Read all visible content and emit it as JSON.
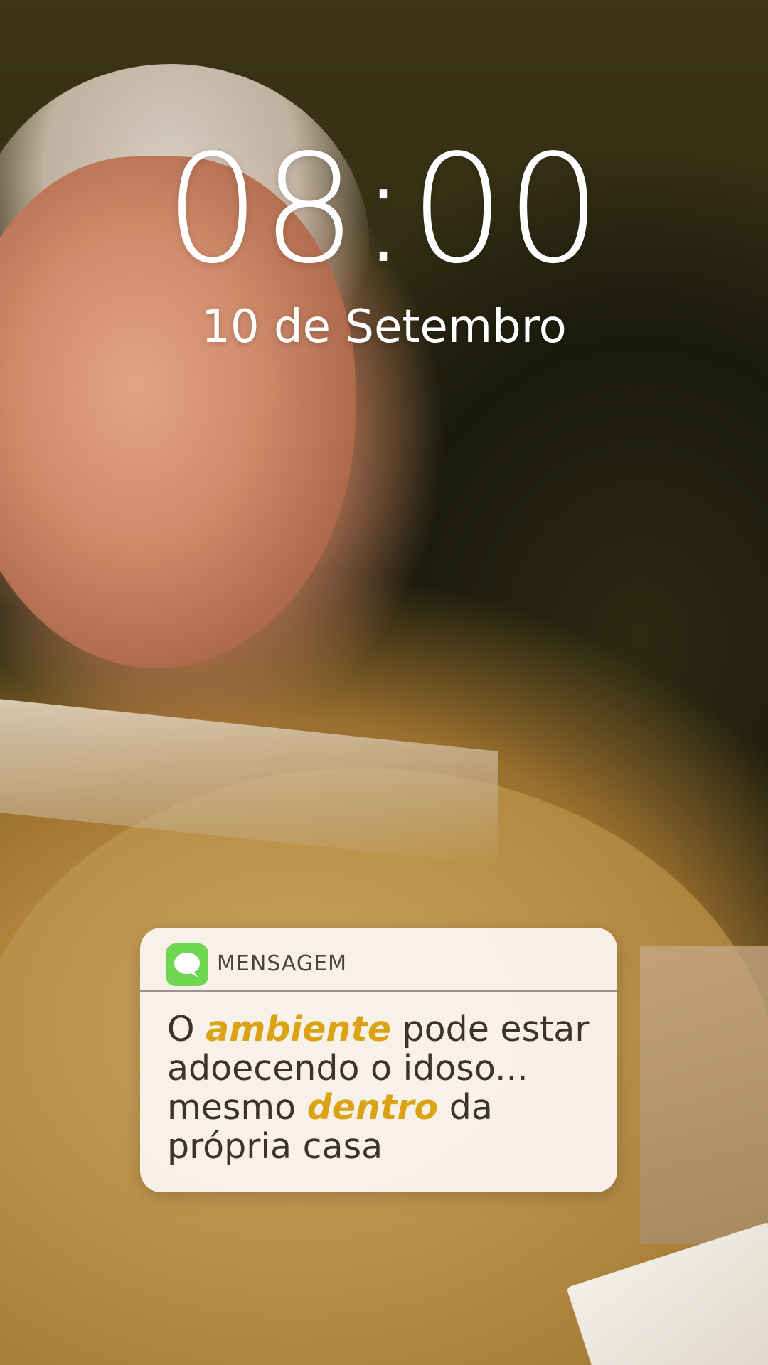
{
  "lock_screen": {
    "time": "08:00",
    "date": "10 de Setembro"
  },
  "notification": {
    "app_icon": "message-bubble-icon",
    "app_name": "MENSAGEM",
    "accent_color": "#dba214",
    "icon_color": "#6fd652",
    "message": {
      "part1": "O ",
      "highlight1": "ambiente",
      "part2": " pode estar adoecendo o idoso... mesmo ",
      "highlight2": "dentro",
      "part3": " da própria casa"
    }
  }
}
